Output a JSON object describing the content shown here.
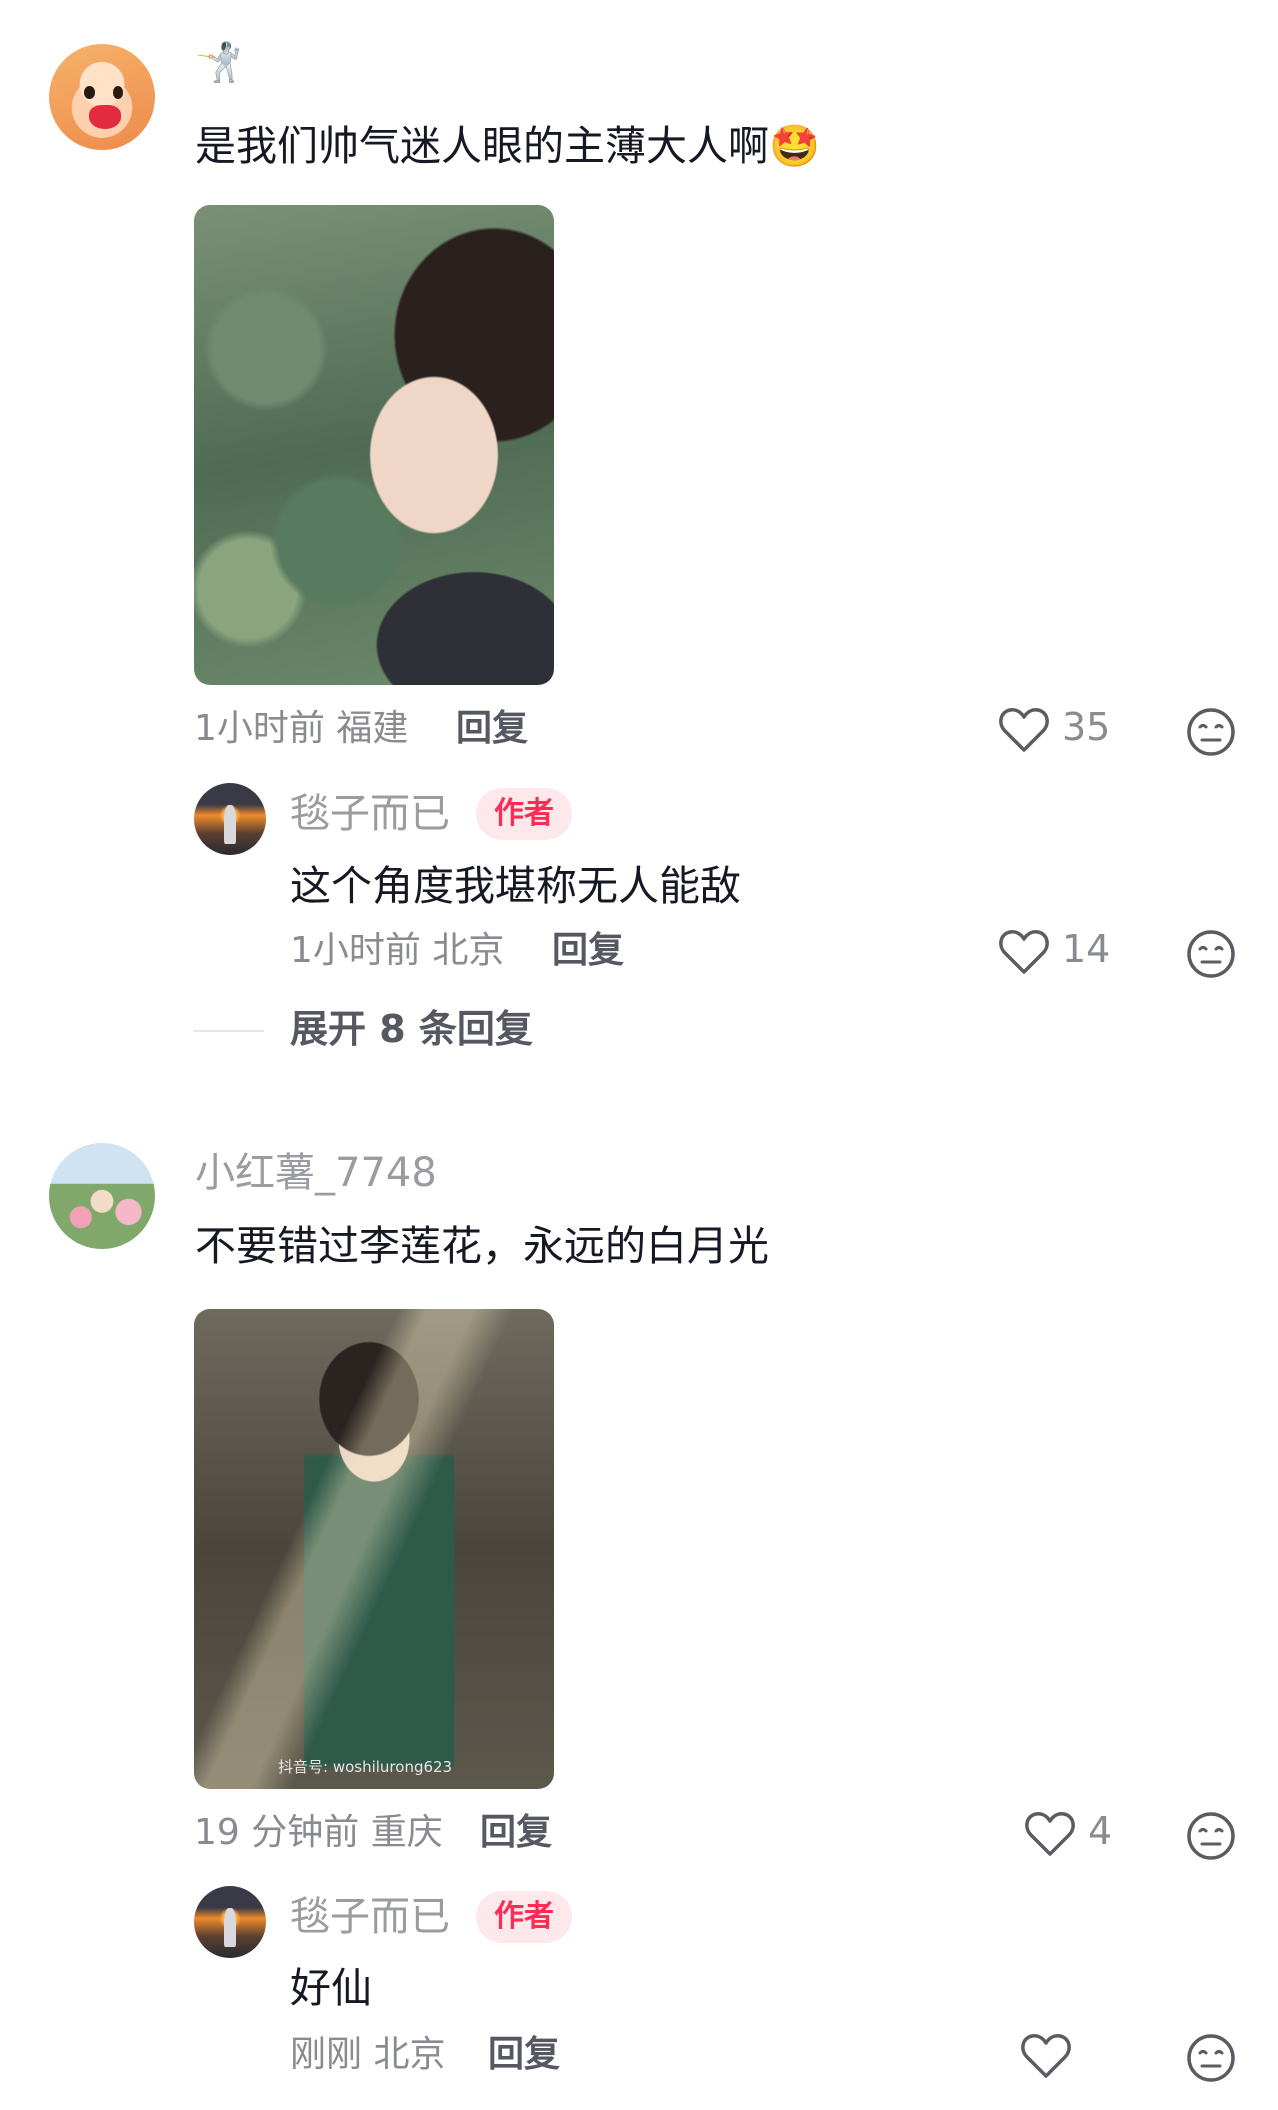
{
  "comments": [
    {
      "username_emoji": "🤺",
      "text": "是我们帅气迷人眼的主薄大人啊🤩",
      "meta": "1小时前 福建",
      "reply_label": "回复",
      "likes": "35",
      "replies": [
        {
          "username": "毯子而已",
          "badge": "作者",
          "text": "这个角度我堪称无人能敌",
          "meta": "1小时前 北京",
          "reply_label": "回复",
          "likes": "14"
        }
      ],
      "expand_label": "展开 8 条回复"
    },
    {
      "username": "小红薯_7748",
      "text": "不要错过李莲花，永远的白月光",
      "image_watermark": "抖音号: woshilurong623",
      "meta": "19 分钟前 重庆",
      "reply_label": "回复",
      "likes": "4",
      "replies": [
        {
          "username": "毯子而已",
          "badge": "作者",
          "text": "好仙",
          "meta": "刚刚 北京",
          "reply_label": "回复",
          "likes": ""
        }
      ]
    }
  ],
  "icons": {
    "like": "heart-outline-icon",
    "dislike": "meh-face-icon"
  },
  "colors": {
    "author_badge_bg": "#fde8ec",
    "author_badge_text": "#fe2c55",
    "secondary_text": "#8a8b91"
  }
}
